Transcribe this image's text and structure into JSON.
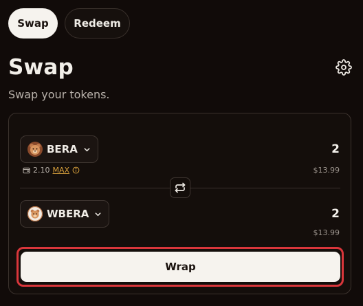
{
  "tabs": {
    "swap": "Swap",
    "redeem": "Redeem"
  },
  "header": {
    "title": "Swap",
    "subtitle": "Swap your tokens.",
    "settings_icon": "gear-icon"
  },
  "from": {
    "token": "BERA",
    "amount": "2",
    "usd": "$13.99",
    "balance": "2.10",
    "max_label": "MAX"
  },
  "to": {
    "token": "WBERA",
    "amount": "2",
    "usd": "$13.99"
  },
  "action": {
    "label": "Wrap"
  },
  "colors": {
    "accent": "#d8a03c",
    "highlight": "#d9363b",
    "primary_button": "#f6f3ee"
  }
}
